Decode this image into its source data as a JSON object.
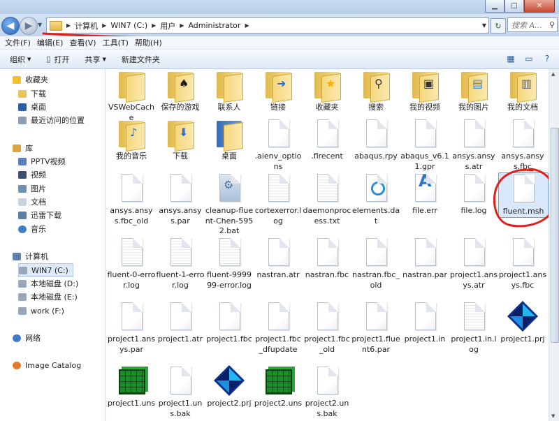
{
  "breadcrumb": [
    "计算机",
    "WIN7 (C:)",
    "用户",
    "Administrator"
  ],
  "search": {
    "placeholder": "搜索 A..."
  },
  "menu": [
    "文件(F)",
    "编辑(E)",
    "查看(V)",
    "工具(T)",
    "帮助(H)"
  ],
  "toolbar": {
    "organize": "组织",
    "open": "打开",
    "share": "共享",
    "new_folder": "新建文件夹"
  },
  "sidebar": {
    "favorites": "收藏夹",
    "fav_items": [
      "下载",
      "桌面",
      "最近访问的位置"
    ],
    "libraries": "库",
    "lib_items": [
      "PPTV视频",
      "视频",
      "图片",
      "文档",
      "迅雷下载",
      "音乐"
    ],
    "computer": "计算机",
    "drives": [
      "WIN7 (C:)",
      "本地磁盘 (D:)",
      "本地磁盘 (E:)",
      "work (F:)"
    ],
    "network": "网络",
    "image_catalog": "Image Catalog"
  },
  "files": [
    "VSWebCache",
    "保存的游戏",
    "联系人",
    "链接",
    "收藏夹",
    "搜索",
    "我的视频",
    "我的图片",
    "我的文档",
    "我的音乐",
    "下载",
    "桌面",
    ".aienv_options",
    ".flrecent",
    "abaqus.rpy",
    "abaqus_v6.11.gpr",
    "ansys.ansys.atr",
    "ansys.ansys.fbc",
    "ansys.ansys.fbc_old",
    "ansys.ansys.par",
    "cleanup-fluent-Chen-5952.bat",
    "cortexerror.log",
    "daemonprocess.txt",
    "elements.dat",
    "file.err",
    "file.log",
    "fluent.msh",
    "fluent-0-error.log",
    "fluent-1-error.log",
    "fluent-999999-error.log",
    "nastran.atr",
    "nastran.fbc",
    "nastran.fbc_old",
    "nastran.par",
    "project1.ansys.atr",
    "project1.ansys.fbc",
    "project1.ansys.par",
    "project1.atr",
    "project1.fbc",
    "project1.fbc_dfupdate",
    "project1.fbc_old",
    "project1.fluent6.par",
    "project1.in",
    "project1.in.log",
    "project1.prj",
    "project1.uns",
    "project1.uns.bak",
    "project2.prj",
    "project2.uns",
    "project2.uns.bak"
  ],
  "colors": {
    "annotation_red": "#e0201a",
    "selection": "#d9e8fb"
  }
}
